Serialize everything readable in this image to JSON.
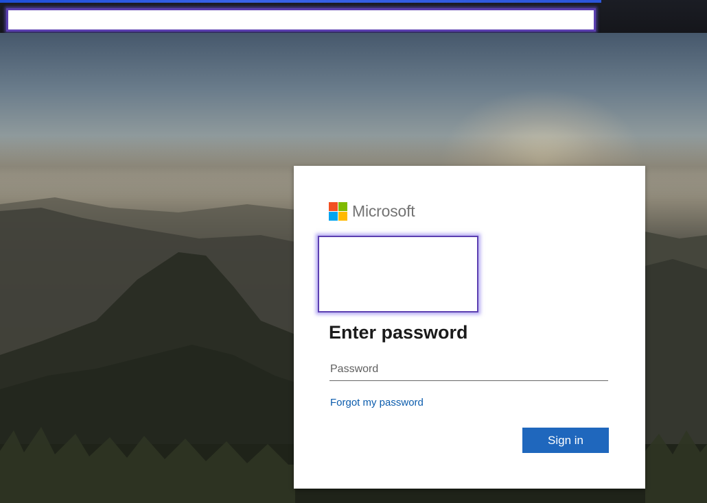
{
  "login": {
    "brand_name": "Microsoft",
    "heading": "Enter password",
    "password_placeholder": "Password",
    "forgot_link": "Forgot my password",
    "signin_label": "Sign in"
  },
  "colors": {
    "logo_red": "#f25022",
    "logo_green": "#7fba00",
    "logo_blue": "#00a4ef",
    "logo_yellow": "#ffb900",
    "primary_button": "#1f67bd",
    "link": "#0b5cad",
    "redaction_border": "#5b3fb0"
  },
  "icons": {
    "brand": "microsoft-logo-icon"
  }
}
